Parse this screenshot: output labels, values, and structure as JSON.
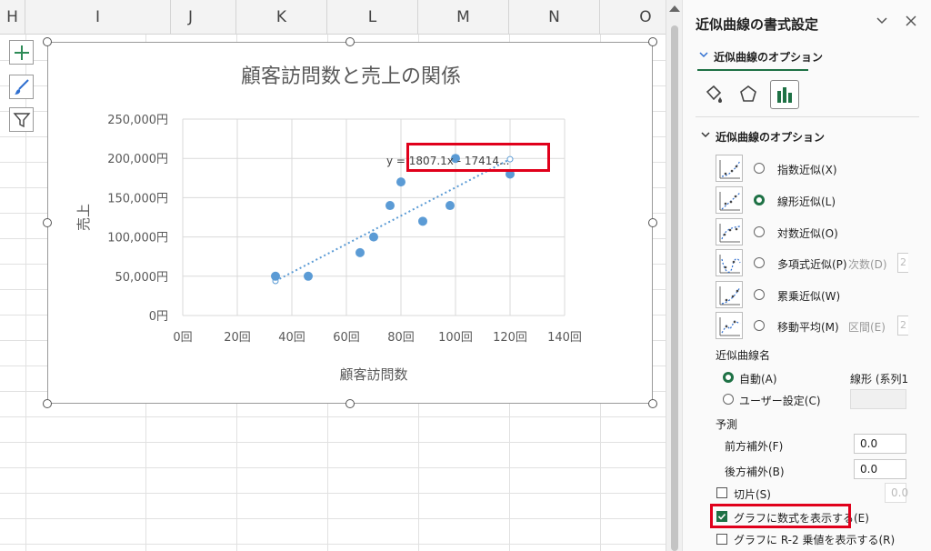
{
  "sheet": {
    "columns": [
      "H",
      "I",
      "J",
      "K",
      "L",
      "M",
      "N",
      "O"
    ]
  },
  "chart_tools": {
    "elements_button": "plus-icon",
    "styles_button": "brush-icon",
    "filter_button": "funnel-icon"
  },
  "chart_data": {
    "type": "scatter",
    "title": "顧客訪問数と売上の関係",
    "xlabel": "顧客訪問数",
    "ylabel": "売上",
    "xlim": [
      0,
      140
    ],
    "ylim": [
      0,
      250000
    ],
    "x_ticks": [
      "0回",
      "20回",
      "40回",
      "60回",
      "80回",
      "100回",
      "120回",
      "140回"
    ],
    "y_ticks": [
      "0円",
      "50,000円",
      "100,000円",
      "150,000円",
      "200,000円",
      "250,000円"
    ],
    "points": [
      {
        "x": 34,
        "y": 50000
      },
      {
        "x": 46,
        "y": 50000
      },
      {
        "x": 65,
        "y": 80000
      },
      {
        "x": 70,
        "y": 100000
      },
      {
        "x": 76,
        "y": 140000
      },
      {
        "x": 80,
        "y": 170000
      },
      {
        "x": 88,
        "y": 120000
      },
      {
        "x": 98,
        "y": 140000
      },
      {
        "x": 100,
        "y": 200000
      },
      {
        "x": 120,
        "y": 180000
      }
    ],
    "trendline": {
      "type": "linear",
      "x_start": 34,
      "x_end": 120,
      "y_start": 44000,
      "y_end": 199000
    },
    "equation_label": "y = 1807.1x - 17414...",
    "grid": true,
    "point_color": "#5b9bd5"
  },
  "pane": {
    "title": "近似曲線の書式設定",
    "collapse_icon": "chevron-down-icon",
    "close_icon": "close-icon",
    "tab_label": "近似曲線のオプション",
    "section_title": "近似曲線のオプション",
    "trend_types": [
      {
        "label": "指数近似(X)",
        "icon": "exponential-trend-icon",
        "selected": false
      },
      {
        "label": "線形近似(L)",
        "icon": "linear-trend-icon",
        "selected": true
      },
      {
        "label": "対数近似(O)",
        "icon": "log-trend-icon",
        "selected": false
      },
      {
        "label": "多項式近似(P)",
        "icon": "polynomial-trend-icon",
        "selected": false
      },
      {
        "label": "累乗近似(W)",
        "icon": "power-trend-icon",
        "selected": false
      },
      {
        "label": "移動平均(M)",
        "icon": "moving-average-icon",
        "selected": false
      }
    ],
    "order_label": "次数(D)",
    "order_value": "2",
    "period_label": "区間(E)",
    "period_value": "2",
    "name_header": "近似曲線名",
    "name_auto_label": "自動(A)",
    "name_auto_value": "線形 (系列1",
    "name_custom_label": "ユーザー設定(C)",
    "forecast_header": "予測",
    "forward_label": "前方補外(F)",
    "forward_value": "0.0",
    "backward_label": "後方補外(B)",
    "backward_value": "0.0",
    "intercept_label": "切片(S)",
    "intercept_value": "0.0",
    "show_equation_label": "グラフに数式を表示する(E)",
    "show_r2_label": "グラフに R-2 乗値を表示する(R)",
    "accent_color": "#1e7145",
    "highlight_color": "#e0001b"
  }
}
